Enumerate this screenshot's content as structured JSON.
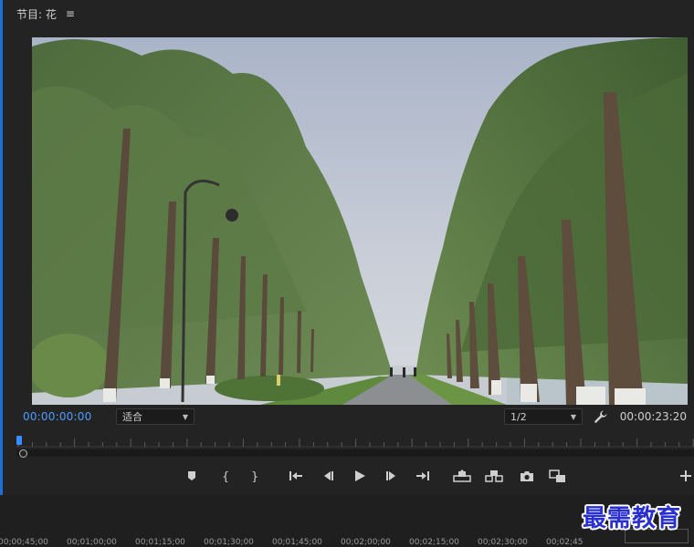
{
  "panel": {
    "title": "节目: 花",
    "menu_icon": "hamburger-menu-icon"
  },
  "viewer": {
    "scene": "tree-lined-path-lakeside"
  },
  "controls": {
    "current_timecode": "00:00:00:00",
    "zoom_select": "适合",
    "resolution_select": "1/2",
    "duration_timecode": "00:00:23:20",
    "settings_icon": "wrench-icon"
  },
  "transport": {
    "buttons": [
      "add-marker-icon",
      "mark-in-icon",
      "mark-out-icon",
      "go-to-in-icon",
      "step-back-icon",
      "play-icon",
      "step-forward-icon",
      "go-to-out-icon",
      "lift-icon",
      "extract-icon",
      "export-frame-icon",
      "compare-view-icon",
      "add-button-icon"
    ]
  },
  "timeline": {
    "labels": [
      "00;00;45;00",
      "00;01;00;00",
      "00;01;15;00",
      "00;01;30;00",
      "00;01;45;00",
      "00;02;00;00",
      "00;02;15;00",
      "00;02;30;00",
      "00;02;45"
    ]
  },
  "watermark": "最需教育",
  "colors": {
    "accent": "#3a8dff",
    "panel_bg": "#232323",
    "timecode_blue": "#4f9cff",
    "watermark_blue": "#2a2fd0"
  }
}
